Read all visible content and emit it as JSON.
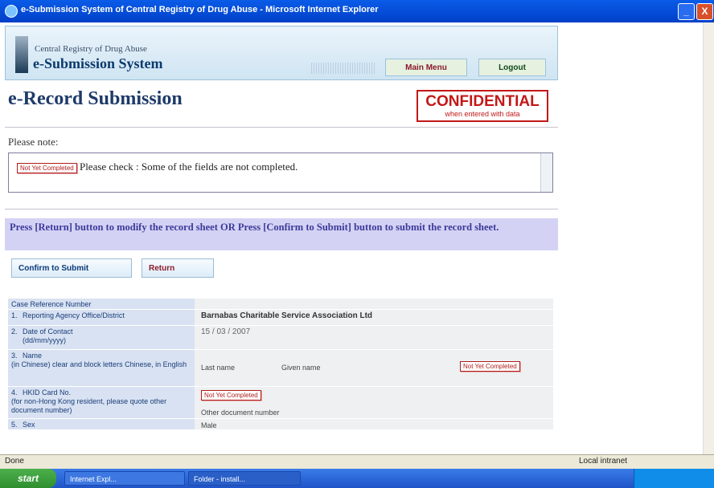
{
  "window": {
    "title": "e-Submission System of Central Registry of Drug Abuse - Microsoft Internet Explorer",
    "min": "_",
    "close": "X"
  },
  "banner": {
    "org": "Central Registry of Drug Abuse",
    "system": "e-Submission System",
    "main_menu": "Main Menu",
    "logout": "Logout"
  },
  "page": {
    "heading": "e-Record Submission",
    "confidential": "CONFIDENTIAL",
    "confidential_sub": "when entered with data"
  },
  "note": {
    "label": "Please note:",
    "tag": "Not Yet Completed",
    "message": "Please check : Some of the fields are not completed."
  },
  "instruction": "Press [Return] button to modify the record sheet OR Press [Confirm to Submit] button to submit the record sheet.",
  "actions": {
    "confirm": "Confirm to Submit",
    "return": "Return"
  },
  "form": {
    "case_ref": {
      "label": "Case Reference Number",
      "value": ""
    },
    "agency": {
      "num": "1.",
      "label": "Reporting Agency Office/District",
      "value": "Barnabas Charitable Service Association Ltd"
    },
    "date": {
      "num": "2.",
      "label": "Date of Contact",
      "hint": "(dd/mm/yyyy)",
      "value": "15 / 03 / 2007"
    },
    "name": {
      "num": "3.",
      "label": "Name",
      "hint": "(in Chinese) clear and block letters Chinese, in English",
      "last": "Last name",
      "given": "Given name",
      "tag": "Not Yet Completed"
    },
    "hkid": {
      "num": "4.",
      "label": "HKID Card No.",
      "hint": "(for non-Hong Kong resident, please quote other document number)",
      "tag": "Not Yet Completed",
      "other": "Other document number"
    },
    "sex": {
      "num": "5.",
      "label": "Sex",
      "value": "Male"
    }
  },
  "status": {
    "done": "Done",
    "zone": "Local intranet"
  },
  "taskbar": {
    "start": "start",
    "task1": "Internet Expl...",
    "task2": "Folder - install..."
  }
}
